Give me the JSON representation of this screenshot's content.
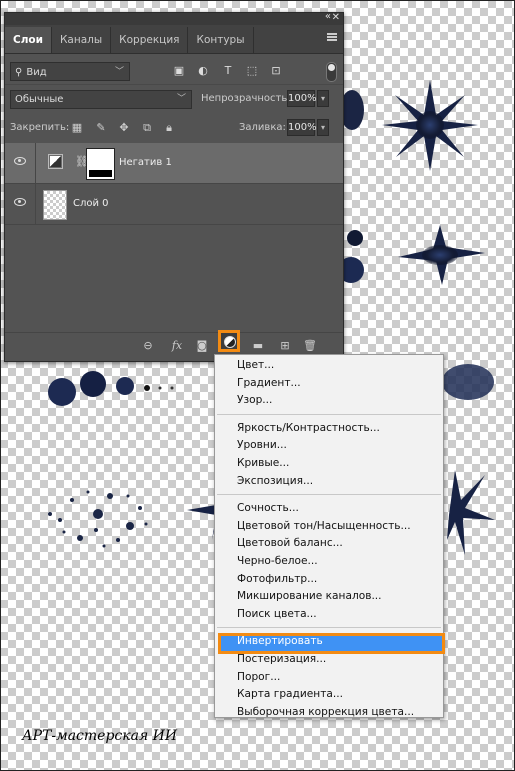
{
  "tabs": [
    "Слои",
    "Каналы",
    "Коррекция",
    "Контуры"
  ],
  "filter": {
    "label": "Вид"
  },
  "blend": {
    "mode": "Обычные",
    "opacity_label": "Непрозрачность:",
    "opacity_value": "100%"
  },
  "lock": {
    "label": "Закрепить:",
    "fill_label": "Заливка:",
    "fill_value": "100%"
  },
  "layers": [
    {
      "name": "Негатив 1"
    },
    {
      "name": "Слой 0"
    }
  ],
  "bottom_icons": [
    "link-icon",
    "fx-icon",
    "mask-icon",
    "adjustment-icon",
    "folder-icon",
    "new-layer-icon",
    "trash-icon"
  ],
  "bottom": {
    "fx": "fx"
  },
  "menu": {
    "groups": [
      [
        "Цвет...",
        "Градиент...",
        "Узор..."
      ],
      [
        "Яркость/Контрастность...",
        "Уровни...",
        "Кривые...",
        "Экспозиция..."
      ],
      [
        "Сочность...",
        "Цветовой тон/Насыщенность...",
        "Цветовой баланс...",
        "Черно-белое...",
        "Фотофильтр...",
        "Микширование каналов...",
        "Поиск цвета..."
      ],
      [
        "Инвертировать",
        "Постеризация...",
        "Порог...",
        "Карта градиента...",
        "Выборочная коррекция цвета..."
      ]
    ],
    "highlighted": "Инвертировать"
  },
  "watermark": "АРТ-мастерская ИИ",
  "colors": {
    "panel": "#535353",
    "highlight": "#f38b13",
    "menu_selection": "#3f92f4",
    "brush": "#1a2545"
  }
}
